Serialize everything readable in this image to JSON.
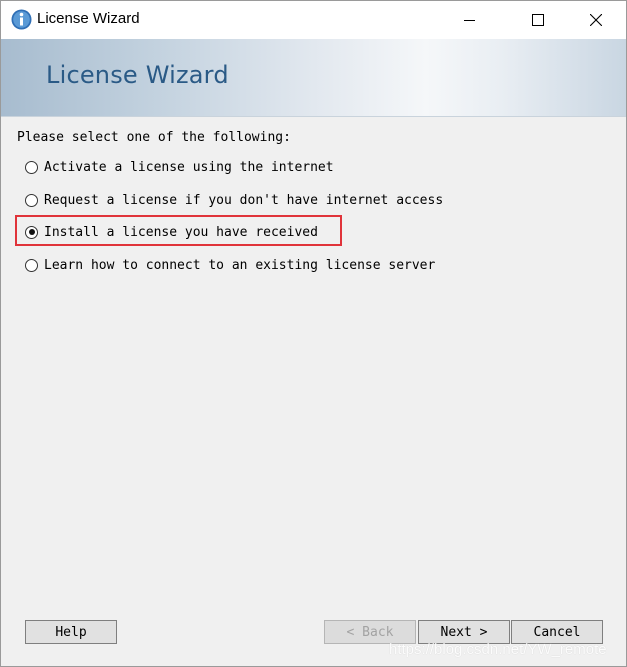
{
  "window": {
    "title": "License Wizard",
    "icon": "info-icon",
    "controls": {
      "minimize": "minimize-icon",
      "maximize": "maximize-icon",
      "close": "close-icon"
    }
  },
  "banner": {
    "title": "License Wizard"
  },
  "form": {
    "prompt": "Please select one of the following:",
    "selected_index": 2,
    "options": [
      {
        "label": "Activate a license using the internet",
        "checked": false
      },
      {
        "label": "Request a license if you don't have internet access",
        "checked": false
      },
      {
        "label": "Install a license you have received",
        "checked": true
      },
      {
        "label": "Learn how to connect to an existing license server",
        "checked": false
      }
    ]
  },
  "buttons": {
    "help": "Help",
    "back": "< Back",
    "next": "Next >",
    "cancel": "Cancel"
  },
  "annotation": {
    "highlight_color": "#e0333a"
  },
  "watermark": "https://blog.csdn.net/YW_remote"
}
